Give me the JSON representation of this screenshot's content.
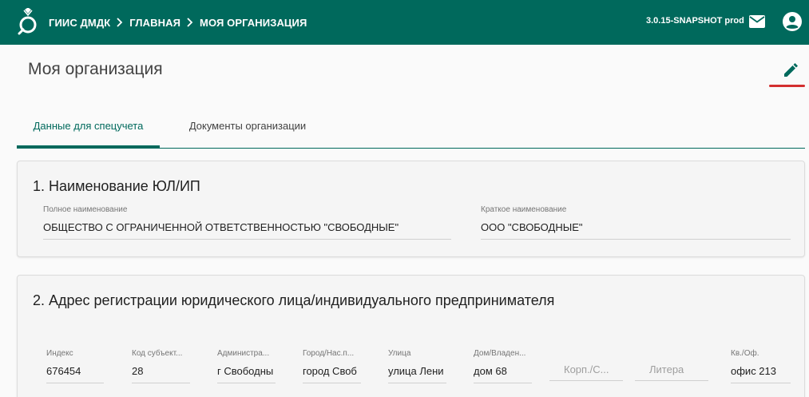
{
  "header": {
    "app_name": "ГИИС ДМДК",
    "crumb_home": "ГЛАВНАЯ",
    "crumb_current": "МОЯ ОРГАНИЗАЦИЯ",
    "version": "3.0.15-SNAPSHOT prod",
    "brand_color": "#00695c"
  },
  "page": {
    "title": "Моя организация"
  },
  "tabs": [
    {
      "label": "Данные для спецучета",
      "active": true
    },
    {
      "label": "Документы организации",
      "active": false
    }
  ],
  "section1": {
    "title": "1. Наименование ЮЛ/ИП",
    "full_name_label": "Полное наименование",
    "full_name_value": "ОБЩЕСТВО С ОГРАНИЧЕННОЙ ОТВЕТСТВЕННОСТЬЮ \"СВОБОДНЫЕ\"",
    "short_name_label": "Краткое наименование",
    "short_name_value": "ООО \"СВОБОДНЫЕ\""
  },
  "section2": {
    "title": "2. Адрес регистрации юридического лица/индивидуального предпринимателя",
    "fields": [
      {
        "label": "Индекс",
        "value": "676454"
      },
      {
        "label": "Код субъект...",
        "value": "28"
      },
      {
        "label": "Администра...",
        "value": "г Свободны"
      },
      {
        "label": "Город/Нас.п...",
        "value": "город Своб"
      },
      {
        "label": "Улица",
        "value": "улица Лени"
      },
      {
        "label": "Дом/Владен...",
        "value": "дом 68"
      },
      {
        "placeholder": "Корп./С..."
      },
      {
        "placeholder": "Литера"
      },
      {
        "label": "Кв./Оф.",
        "value": "офис 213"
      }
    ]
  }
}
